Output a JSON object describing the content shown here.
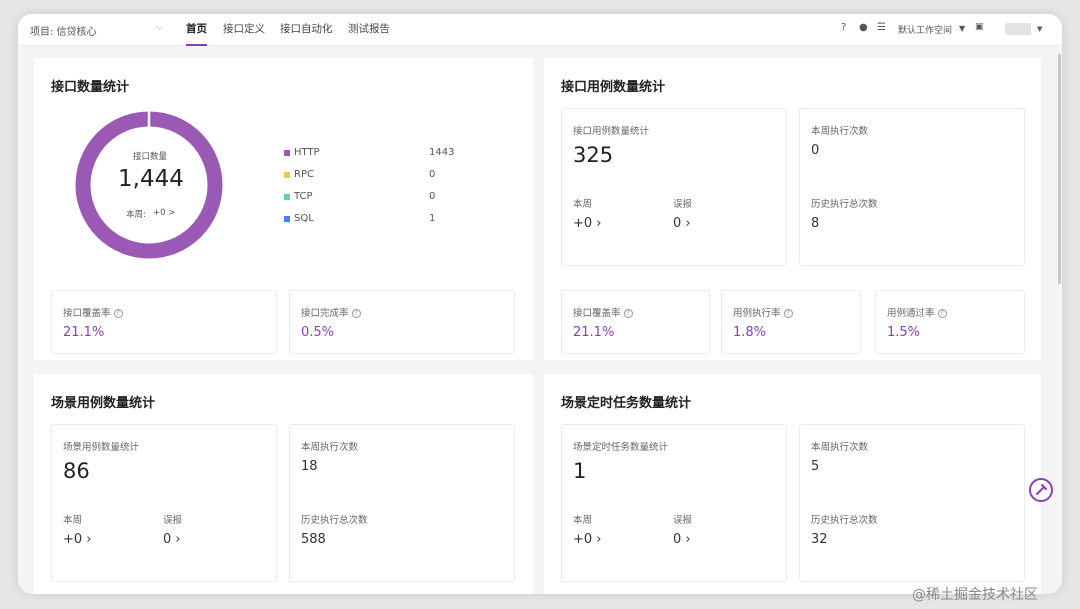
{
  "header": {
    "project": "项目: 信贷核心",
    "nav": [
      "首页",
      "接口定义",
      "接口自动化",
      "测试报告"
    ],
    "workspace": "默认工作空间"
  },
  "api_stats": {
    "title": "接口数量统计",
    "donut_label": "接口数量",
    "total": "1,444",
    "week": "本周:",
    "week_value": "+0 >",
    "legend": [
      {
        "name": "HTTP",
        "value": "1443",
        "color": "#9b59b6"
      },
      {
        "name": "RPC",
        "value": "0",
        "color": "#f1c45a"
      },
      {
        "name": "TCP",
        "value": "0",
        "color": "#5fd3b0"
      },
      {
        "name": "SQL",
        "value": "1",
        "color": "#4a7ef5"
      }
    ],
    "coverage_label": "接口覆盖率",
    "coverage": "21.1%",
    "completion_label": "接口完成率",
    "completion": "0.5%"
  },
  "case_stats": {
    "title": "接口用例数量统计",
    "count_label": "接口用例数量统计",
    "count": "325",
    "week_label": "本周",
    "week_value": "+0",
    "false_label": "误报",
    "false_value": "0",
    "week_exec_label": "本周执行次数",
    "week_exec": "0",
    "total_exec_label": "历史执行总次数",
    "total_exec": "8",
    "coverage_label": "接口覆盖率",
    "coverage": "21.1%",
    "exec_rate_label": "用例执行率",
    "exec_rate": "1.8%",
    "pass_rate_label": "用例通过率",
    "pass_rate": "1.5%"
  },
  "scenario_stats": {
    "title": "场景用例数量统计",
    "count_label": "场景用例数量统计",
    "count": "86",
    "week_label": "本周",
    "week_value": "+0",
    "false_label": "误报",
    "false_value": "0",
    "week_exec_label": "本周执行次数",
    "week_exec": "18",
    "total_exec_label": "历史执行总次数",
    "total_exec": "588"
  },
  "task_stats": {
    "title": "场景定时任务数量统计",
    "count_label": "场景定时任务数量统计",
    "count": "1",
    "week_label": "本周",
    "week_value": "+0",
    "false_label": "误报",
    "false_value": "0",
    "week_exec_label": "本周执行次数",
    "week_exec": "5",
    "total_exec_label": "历史执行总次数",
    "total_exec": "32"
  },
  "watermark": "@稀土掘金技术社区",
  "colors": {
    "accent": "#8b3fb7",
    "donut": "#9b59b6"
  }
}
